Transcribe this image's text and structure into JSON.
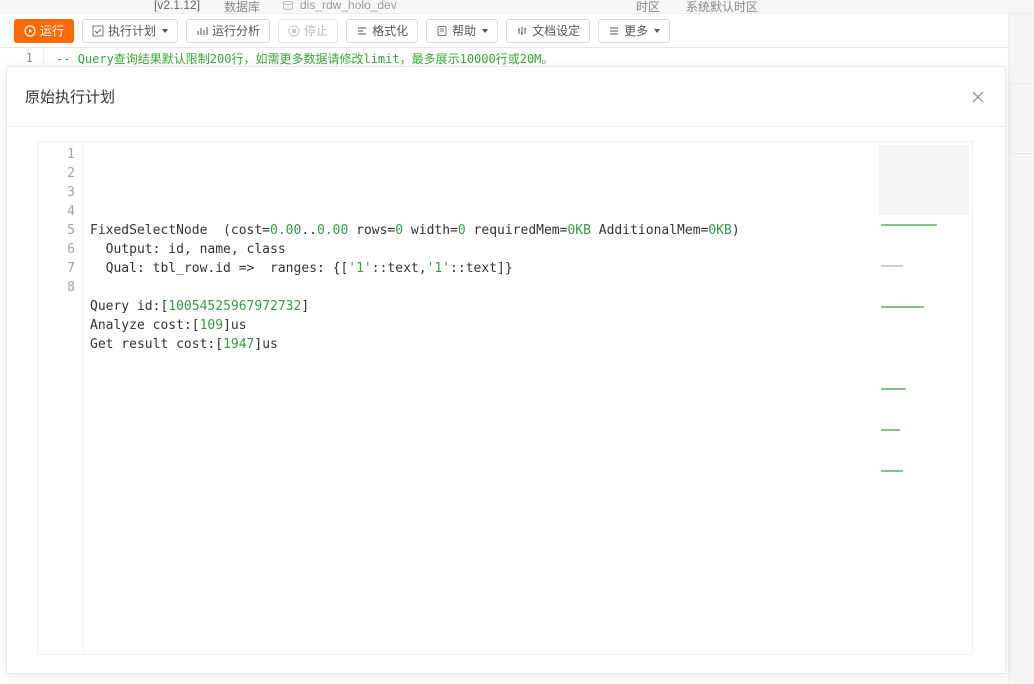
{
  "topBar": {
    "version": "[v2.1.12]",
    "dbLabel": "数据库",
    "dbName": "dis_rdw_holo_dev",
    "tzLabel": "时区",
    "tzValue": "系统默认时区"
  },
  "toolbar": {
    "run": "运行",
    "plan": "执行计划",
    "analyze": "运行分析",
    "stop": "停止",
    "format": "格式化",
    "help": "帮助",
    "docset": "文档设定",
    "more": "更多"
  },
  "editor": {
    "lineNo": "1",
    "commentPrefix": "-- ",
    "commentBody": "Query查询结果默认限制200行，如需更多数据请修改limit，最多展示10000行或20M。"
  },
  "modal": {
    "title": "原始执行计划",
    "lines": [
      {
        "n": 1,
        "segs": []
      },
      {
        "n": 2,
        "segs": [
          {
            "t": "FixedSelectNode  (cost="
          },
          {
            "t": "0.00",
            "c": "nn"
          },
          {
            "t": ".."
          },
          {
            "t": "0.00",
            "c": "nn"
          },
          {
            "t": " rows="
          },
          {
            "t": "0",
            "c": "nn"
          },
          {
            "t": " width="
          },
          {
            "t": "0",
            "c": "nn"
          },
          {
            "t": " requiredMem="
          },
          {
            "t": "0KB",
            "c": "nn"
          },
          {
            "t": " AdditionalMem="
          },
          {
            "t": "0KB",
            "c": "nn"
          },
          {
            "t": ")"
          }
        ]
      },
      {
        "n": 3,
        "segs": [
          {
            "t": "  Output: id, name, class"
          }
        ]
      },
      {
        "n": 4,
        "segs": [
          {
            "t": "  Qual: tbl_row.id =>  ranges: {["
          },
          {
            "t": "'1'",
            "c": "nn"
          },
          {
            "t": "::text,"
          },
          {
            "t": "'1'",
            "c": "nn"
          },
          {
            "t": "::text]}"
          }
        ]
      },
      {
        "n": 5,
        "segs": []
      },
      {
        "n": 6,
        "segs": [
          {
            "t": "Query id:["
          },
          {
            "t": "10054525967972732",
            "c": "nn"
          },
          {
            "t": "]"
          }
        ]
      },
      {
        "n": 7,
        "segs": [
          {
            "t": "Analyze cost:["
          },
          {
            "t": "109",
            "c": "nn"
          },
          {
            "t": "]us"
          }
        ]
      },
      {
        "n": 8,
        "segs": [
          {
            "t": "Get result cost:["
          },
          {
            "t": "1947",
            "c": "nn"
          },
          {
            "t": "]us"
          }
        ]
      }
    ]
  }
}
